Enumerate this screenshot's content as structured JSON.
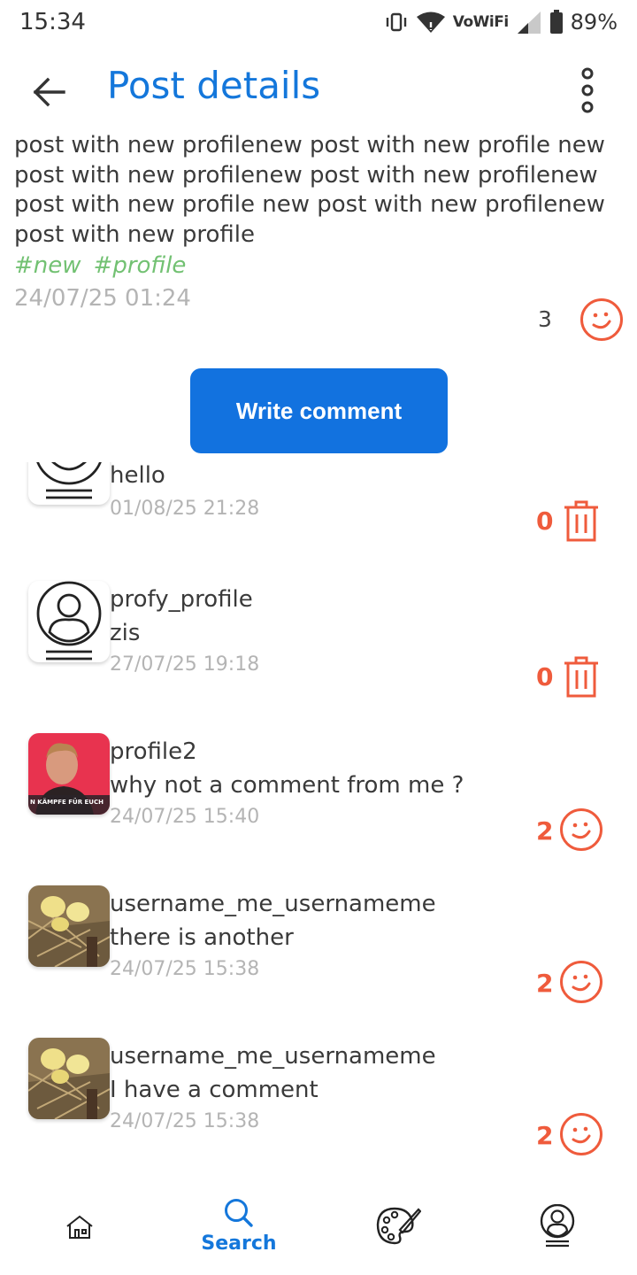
{
  "status_bar": {
    "time": "15:34",
    "network_label": "VoWiFi",
    "battery": "89%"
  },
  "header": {
    "title": "Post details",
    "back_icon": "arrow-left-icon",
    "menu_icon": "more-vertical-icon"
  },
  "post": {
    "text": "post with new profilenew post with new profile new post with new profilenew post with new profilenew post with new profile new post with new profilenew post with new profile",
    "hashtags": [
      "#new",
      "#profile"
    ],
    "date": "24/07/25 01:24",
    "reaction_count": "3",
    "reaction_icon": "smiley-icon"
  },
  "write_comment_label": "Write comment",
  "comments": [
    {
      "username": "",
      "text": "hello",
      "date": "01/08/25 21:28",
      "count": "0",
      "action_icon": "trash-icon",
      "avatar": "default-profile-icon"
    },
    {
      "username": "profy_profile",
      "text": "zis",
      "date": "27/07/25 19:18",
      "count": "0",
      "action_icon": "trash-icon",
      "avatar": "default-profile-icon"
    },
    {
      "username": "profile2",
      "text": "why not a comment from me ?",
      "date": "24/07/25 15:40",
      "count": "2",
      "action_icon": "smiley-icon",
      "avatar": "photo-man-red-background"
    },
    {
      "username": "username_me_usernameme",
      "text": "there is another",
      "date": "24/07/25 15:38",
      "count": "2",
      "action_icon": "smiley-icon",
      "avatar": "photo-ducklings"
    },
    {
      "username": "username_me_usernameme",
      "text": "I have a comment",
      "date": "24/07/25 15:38",
      "count": "2",
      "action_icon": "smiley-icon",
      "avatar": "photo-ducklings"
    }
  ],
  "bottom_nav": {
    "items": [
      {
        "icon": "home-icon",
        "label": ""
      },
      {
        "icon": "search-icon",
        "label": "Search",
        "active": true
      },
      {
        "icon": "palette-icon",
        "label": ""
      },
      {
        "icon": "profile-icon",
        "label": ""
      }
    ]
  },
  "colors": {
    "accent": "#1477db",
    "button": "#1272df",
    "reaction": "#ef5b3c",
    "hashtag": "#72c172",
    "muted": "#b4b4b4"
  }
}
